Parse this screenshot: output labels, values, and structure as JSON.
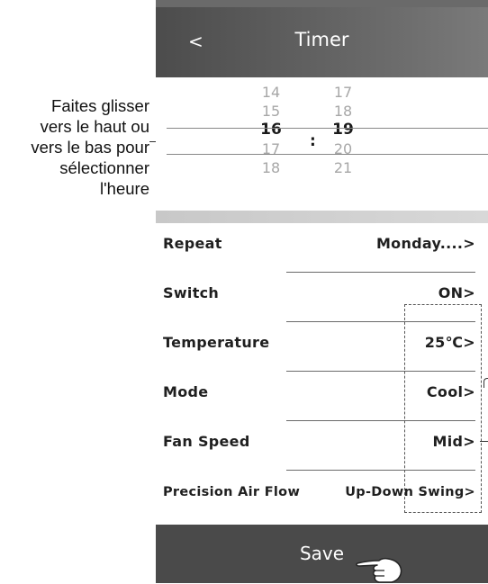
{
  "annotation": {
    "lines": [
      "Faites glisser",
      "vers le haut ou",
      "vers le bas pour",
      "sélectionner",
      "l'heure"
    ]
  },
  "header": {
    "back_label": "<",
    "title": "Timer"
  },
  "time_picker": {
    "hours": [
      "14",
      "15",
      "16",
      "17",
      "18"
    ],
    "minutes": [
      "17",
      "18",
      "19",
      "20",
      "21"
    ],
    "selected_hour": "16",
    "selected_minute": "19",
    "separator": ":"
  },
  "settings": [
    {
      "label": "Repeat",
      "value": "Monday....>"
    },
    {
      "label": "Switch",
      "value": "ON>"
    },
    {
      "label": "Temperature",
      "value": "25℃>"
    },
    {
      "label": "Mode",
      "value": "Cool>"
    },
    {
      "label": "Fan Speed",
      "value": "Mid>"
    },
    {
      "label": "Precision Air Flow",
      "value": "Up-Down Swing>"
    }
  ],
  "footer": {
    "save_label": "Save"
  },
  "colors": {
    "header_bg": "#5a5a5a",
    "save_bar_bg": "#4a4a4a",
    "selected_text": "#1a1a1a",
    "unselected_text": "#a7a7a7"
  },
  "icons": {
    "back": "chevron-left-icon",
    "tap": "pointing-hand-icon"
  }
}
